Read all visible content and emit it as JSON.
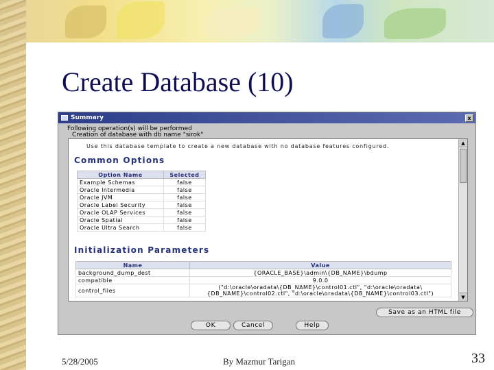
{
  "slide": {
    "title": "Create Database (10)",
    "footer_date": "5/28/2005",
    "footer_author": "By Mazmur Tarigan",
    "page_number": "33"
  },
  "dialog": {
    "window_title": "Summary",
    "close_label": "x",
    "header_line1": "Following operation(s) will be performed",
    "header_line2": "Creation of database with db name \"sirok\"",
    "description": "Use this database template to create a new database with no database features configured.",
    "common_options": {
      "heading": "Common Options",
      "columns": [
        "Option Name",
        "Selected"
      ],
      "rows": [
        [
          "Example Schemas",
          "false"
        ],
        [
          "Oracle Intermedia",
          "false"
        ],
        [
          "Oracle JVM",
          "false"
        ],
        [
          "Oracle Label Security",
          "false"
        ],
        [
          "Oracle OLAP Services",
          "false"
        ],
        [
          "Oracle Spatial",
          "false"
        ],
        [
          "Oracle Ultra Search",
          "false"
        ]
      ]
    },
    "init_params": {
      "heading": "Initialization Parameters",
      "columns": [
        "Name",
        "Value"
      ],
      "rows": [
        [
          "background_dump_dest",
          "{ORACLE_BASE}\\admin\\{DB_NAME}\\bdump"
        ],
        [
          "compatible",
          "9.0.0"
        ],
        [
          "control_files",
          "(\"d:\\oracle\\oradata\\{DB_NAME}\\control01.ctl\", \"d:\\oracle\\oradata\\{DB_NAME}\\control02.ctl\", \"d:\\oracle\\oradata\\{DB_NAME}\\control03.ctl\")"
        ]
      ]
    },
    "buttons": {
      "save_html": "Save as an HTML file",
      "ok": "OK",
      "cancel": "Cancel",
      "help": "Help"
    }
  }
}
